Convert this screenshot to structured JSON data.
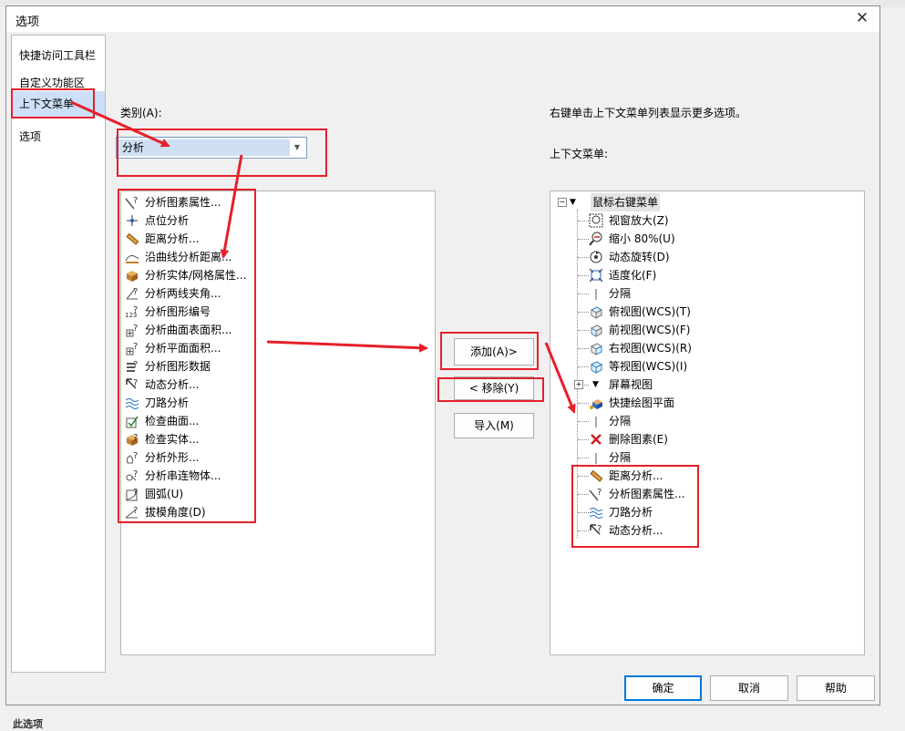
{
  "window": {
    "title": "选项",
    "close_glyph": "✕"
  },
  "nav": {
    "items": [
      "快捷访问工具栏",
      "自定义功能区",
      "上下文菜单",
      "选项"
    ],
    "selected_index": 2
  },
  "left_panel": {
    "category_label": "类别(A):",
    "category_value": "分析",
    "items": [
      {
        "label": "分析图素属性...",
        "icon": "analyze-entity-icon"
      },
      {
        "label": "点位分析",
        "icon": "point-analysis-icon"
      },
      {
        "label": "距离分析...",
        "icon": "ruler-icon"
      },
      {
        "label": "沿曲线分析距离...",
        "icon": "curve-distance-icon"
      },
      {
        "label": "分析实体/网格属性...",
        "icon": "solid-mesh-icon"
      },
      {
        "label": "分析两线夹角...",
        "icon": "angle-icon"
      },
      {
        "label": "分析图形编号",
        "icon": "number-icon"
      },
      {
        "label": "分析曲面表面积...",
        "icon": "surface-area-icon"
      },
      {
        "label": "分析平面面积...",
        "icon": "plane-area-icon"
      },
      {
        "label": "分析图形数据",
        "icon": "data-icon"
      },
      {
        "label": "动态分析...",
        "icon": "dynamic-analysis-icon"
      },
      {
        "label": "刀路分析",
        "icon": "toolpath-icon"
      },
      {
        "label": "检查曲面...",
        "icon": "check-surface-icon"
      },
      {
        "label": "检查实体...",
        "icon": "check-solid-icon"
      },
      {
        "label": "分析外形...",
        "icon": "contour-icon"
      },
      {
        "label": "分析串连物体...",
        "icon": "chain-icon"
      },
      {
        "label": "圆弧(U)",
        "icon": "arc-icon"
      },
      {
        "label": "拔模角度(D)",
        "icon": "draft-angle-icon"
      }
    ]
  },
  "middle_buttons": {
    "add": "添加(A)>",
    "remove": "< 移除(Y)",
    "import": "导入(M)"
  },
  "right_panel": {
    "hint": "右键单击上下文菜单列表显示更多选项。",
    "menu_label": "上下文菜单:",
    "root": "鼠标右键菜单",
    "items": [
      {
        "label": "视窗放大(Z)",
        "icon": "zoom-window-icon"
      },
      {
        "label": "缩小 80%(U)",
        "icon": "zoom-out-icon"
      },
      {
        "label": "动态旋转(D)",
        "icon": "rotate-icon"
      },
      {
        "label": "适度化(F)",
        "icon": "fit-icon"
      },
      {
        "label": "分隔",
        "icon": "separator-icon"
      },
      {
        "label": "俯视图(WCS)(T)",
        "icon": "top-view-icon"
      },
      {
        "label": "前视图(WCS)(F)",
        "icon": "front-view-icon"
      },
      {
        "label": "右视图(WCS)(R)",
        "icon": "right-view-icon"
      },
      {
        "label": "等视图(WCS)(I)",
        "icon": "iso-view-icon"
      },
      {
        "label": "屏幕视图",
        "icon": "screen-view-icon"
      },
      {
        "label": "快捷绘图平面",
        "icon": "quick-plane-icon"
      },
      {
        "label": "分隔",
        "icon": "separator-icon"
      },
      {
        "label": "删除图素(E)",
        "icon": "delete-icon"
      },
      {
        "label": "分隔",
        "icon": "separator-icon"
      },
      {
        "label": "距离分析...",
        "icon": "ruler-icon"
      },
      {
        "label": "分析图素属性...",
        "icon": "analyze-entity-icon"
      },
      {
        "label": "刀路分析",
        "icon": "toolpath-icon"
      },
      {
        "label": "动态分析...",
        "icon": "dynamic-analysis-icon"
      }
    ]
  },
  "footer": {
    "ok": "确定",
    "cancel": "取消",
    "help": "帮助"
  },
  "bottom_text": "此选项",
  "colors": {
    "annotation_red": "#e6202a",
    "selection_blue": "#cde0f7",
    "primary_border": "#0078d7"
  }
}
